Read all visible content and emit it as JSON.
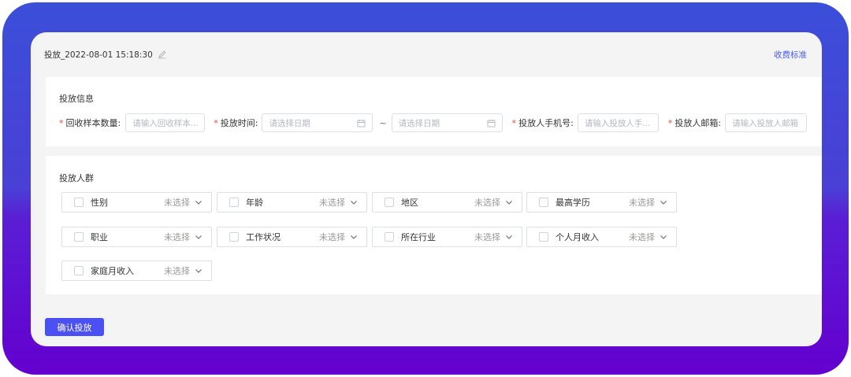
{
  "header": {
    "title": "投放_2022-08-01 15:18:30",
    "fee_link": "收费标准"
  },
  "info": {
    "section_title": "投放信息",
    "fields": {
      "sample_count": {
        "label": "回收样本数量:",
        "placeholder": "请输入回收样本..."
      },
      "time": {
        "label": "投放时间:",
        "start_placeholder": "请选择日期",
        "separator": "~",
        "end_placeholder": "请选择日期"
      },
      "phone": {
        "label": "投放人手机号:",
        "placeholder": "请输入投放人手..."
      },
      "email": {
        "label": "投放人邮箱:",
        "placeholder": "请输入投放人邮箱"
      }
    },
    "required_mark": "*"
  },
  "crowd": {
    "section_title": "投放人群",
    "items": [
      {
        "name": "性别",
        "value": "未选择"
      },
      {
        "name": "年龄",
        "value": "未选择"
      },
      {
        "name": "地区",
        "value": "未选择"
      },
      {
        "name": "最高学历",
        "value": "未选择"
      },
      {
        "name": "职业",
        "value": "未选择"
      },
      {
        "name": "工作状况",
        "value": "未选择"
      },
      {
        "name": "所在行业",
        "value": "未选择"
      },
      {
        "name": "个人月收入",
        "value": "未选择"
      },
      {
        "name": "家庭月收入",
        "value": "未选择"
      }
    ]
  },
  "actions": {
    "confirm_label": "确认投放"
  },
  "colors": {
    "accent": "#4a50f2",
    "link": "#4a5cf0",
    "required": "#f04848",
    "frame_top": "#3b4fd9",
    "frame_bottom": "#6400cf"
  }
}
